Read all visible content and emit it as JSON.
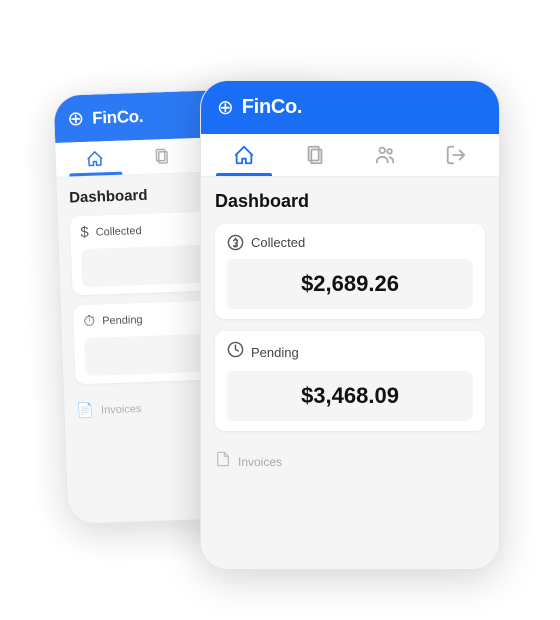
{
  "app": {
    "brand": "FinCo.",
    "title": "Dashboard"
  },
  "nav": {
    "tabs": [
      {
        "label": "home",
        "icon": "home",
        "active": true
      },
      {
        "label": "documents",
        "icon": "documents",
        "active": false
      },
      {
        "label": "people",
        "icon": "people",
        "active": false
      },
      {
        "label": "logout",
        "icon": "logout",
        "active": false
      }
    ]
  },
  "cards": [
    {
      "label": "Collected",
      "icon": "dollar-circle",
      "value": "$2,689.26"
    },
    {
      "label": "Pending",
      "icon": "clock",
      "value": "$3,468.09"
    }
  ],
  "invoices": {
    "label": "Invoices"
  }
}
